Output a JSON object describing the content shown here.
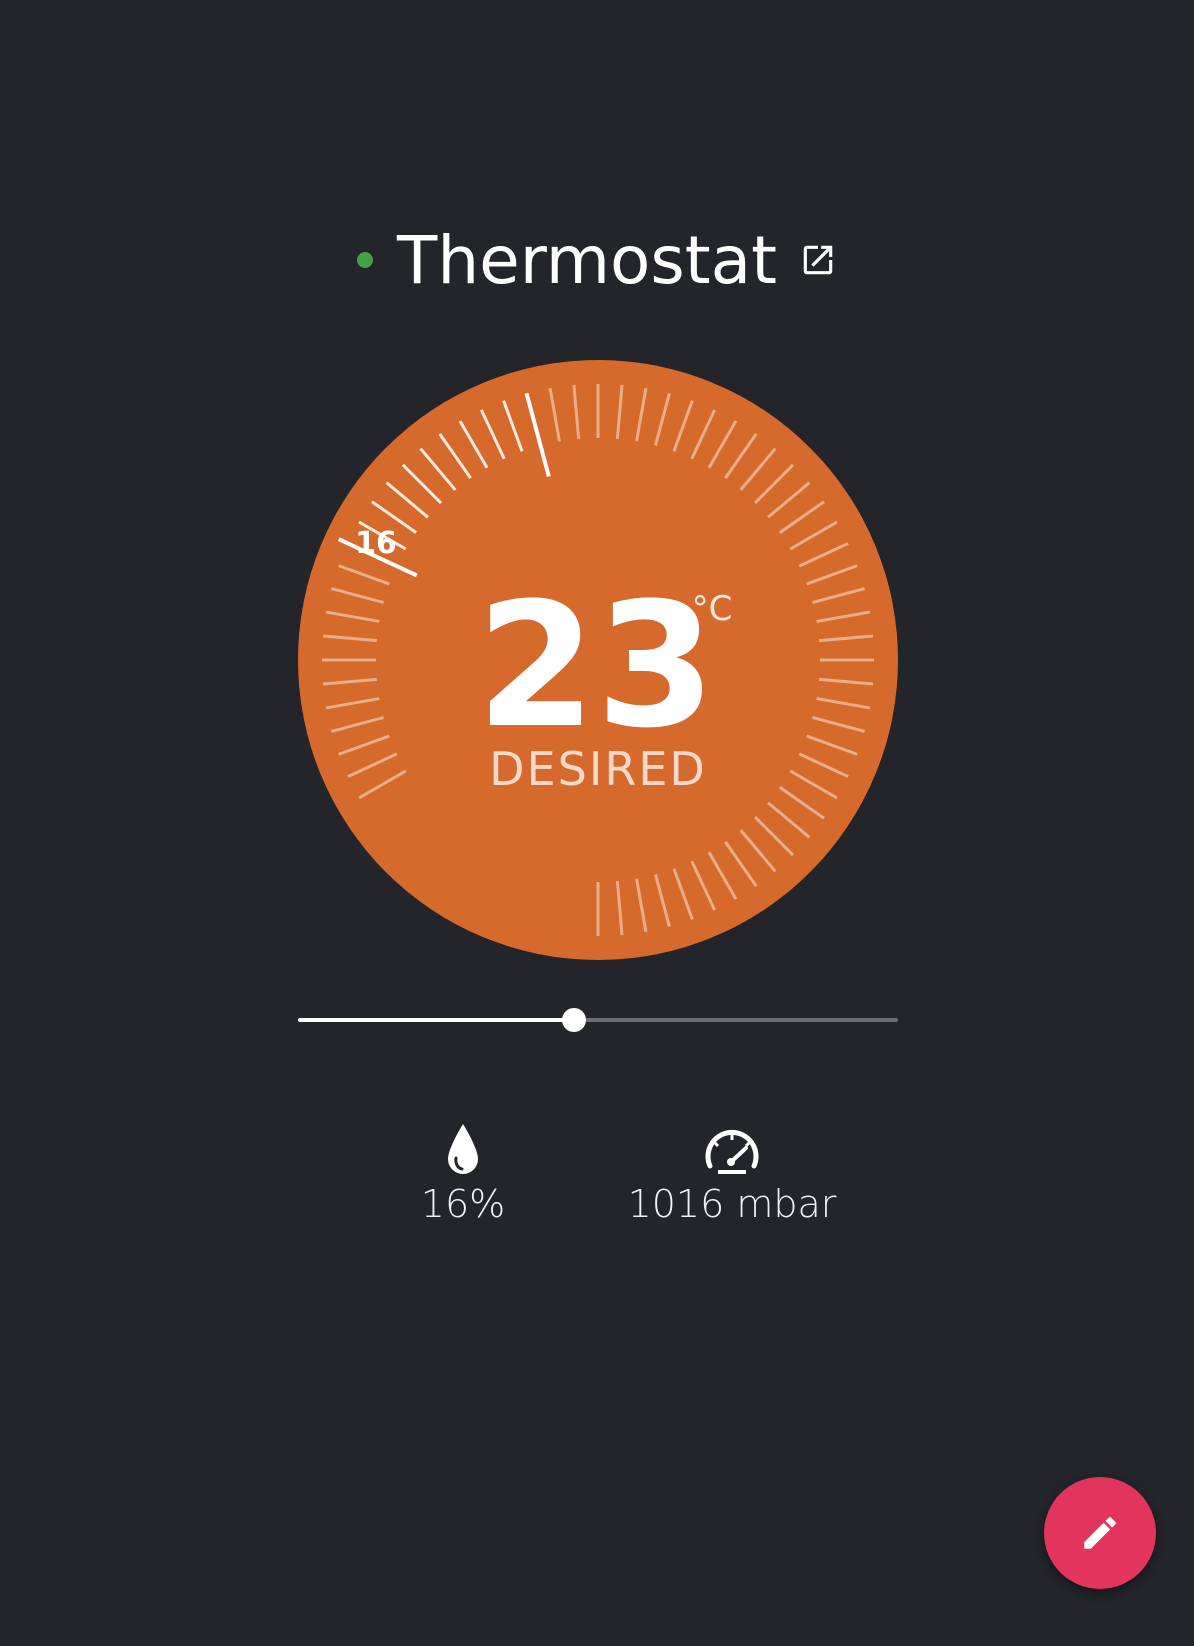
{
  "header": {
    "title": "Thermostat",
    "status_color": "#43a047",
    "status_icon": "status-dot",
    "link_icon": "open-in-new-icon"
  },
  "dial": {
    "background_color": "#d66a2c",
    "desired_value": "23",
    "unit": "°C",
    "mode_label": "DESIRED",
    "current_temp_label": "16",
    "current_temp": 16,
    "target_temp": 23
  },
  "slider": {
    "value_fraction": 0.46
  },
  "stats": {
    "humidity": {
      "icon": "water-drop-icon",
      "value": "16%"
    },
    "pressure": {
      "icon": "gauge-icon",
      "value": "1016 mbar"
    }
  },
  "fab": {
    "icon": "pencil-icon",
    "color": "#e3345e"
  }
}
